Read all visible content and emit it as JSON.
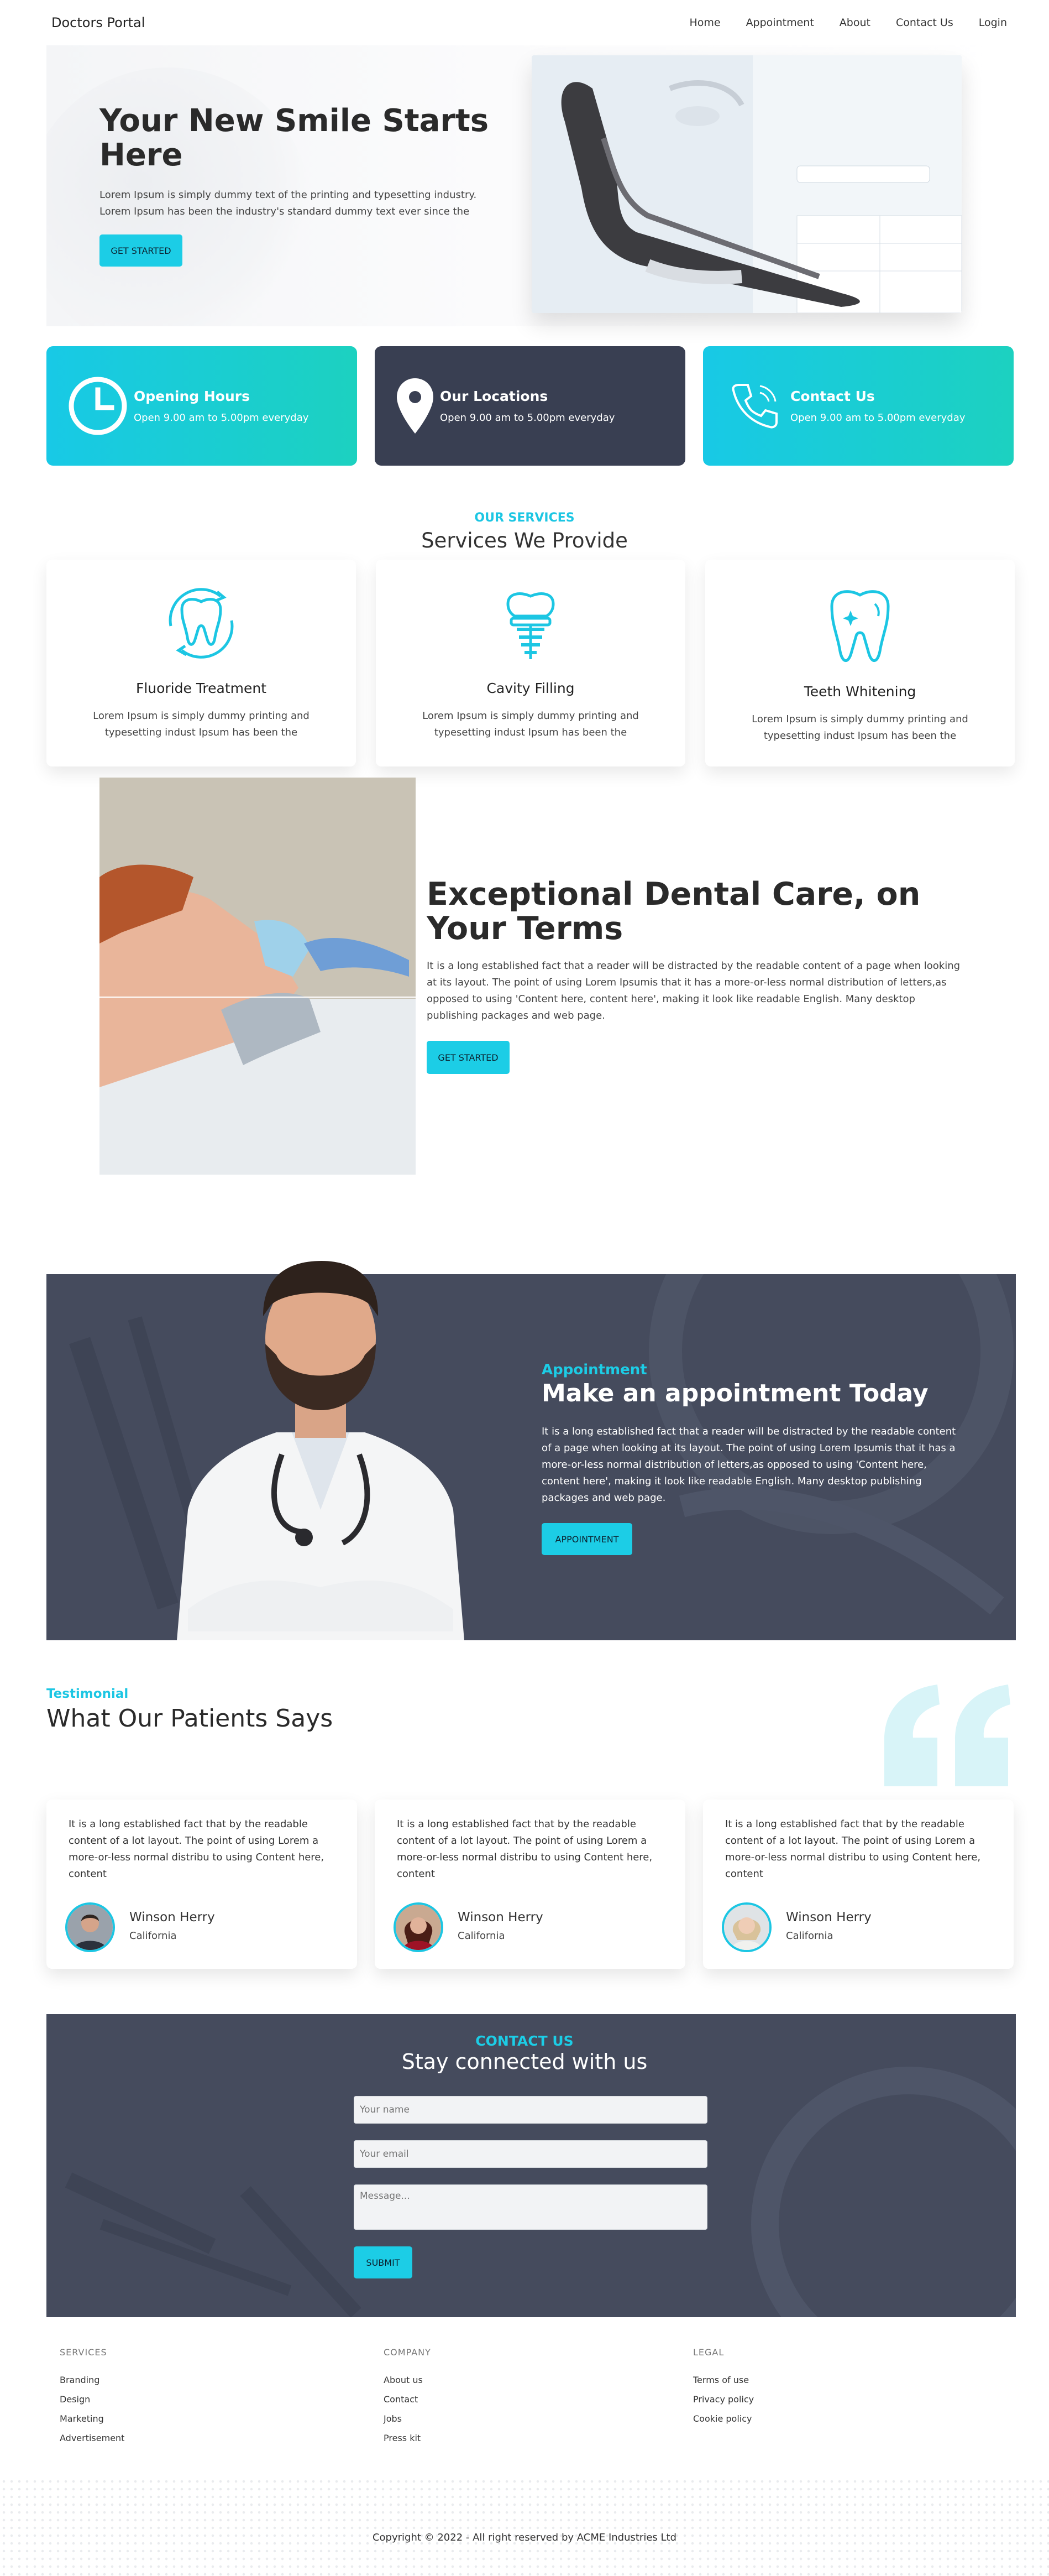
{
  "nav": {
    "brand": "Doctors Portal",
    "items": [
      "Home",
      "Appointment",
      "About",
      "Contact Us",
      "Login"
    ]
  },
  "hero": {
    "title": "Your New Smile Starts Here",
    "text": "Lorem Ipsum is simply dummy text of the printing and typesetting industry. Lorem Ipsum has been the industry's standard dummy text ever since the",
    "button": "GET STARTED"
  },
  "info": [
    {
      "title": "Opening Hours",
      "text": "Open 9.00 am to 5.00pm everyday",
      "icon": "clock-icon"
    },
    {
      "title": "Our Locations",
      "text": "Open 9.00 am to 5.00pm everyday",
      "icon": "location-pin-icon"
    },
    {
      "title": "Contact Us",
      "text": "Open 9.00 am to 5.00pm everyday",
      "icon": "phone-icon"
    }
  ],
  "services": {
    "eyebrow": "OUR SERVICES",
    "title": "Services We Provide",
    "items": [
      {
        "name": "Fluoride Treatment",
        "desc": "Lorem Ipsum is simply dummy printing and typesetting indust Ipsum has been the",
        "icon": "tooth-fluoride-icon"
      },
      {
        "name": "Cavity Filling",
        "desc": "Lorem Ipsum is simply dummy printing and typesetting indust Ipsum has been the",
        "icon": "tooth-implant-icon"
      },
      {
        "name": "Teeth Whitening",
        "desc": "Lorem Ipsum is simply dummy printing and typesetting indust Ipsum has been the",
        "icon": "tooth-sparkle-icon"
      }
    ]
  },
  "care": {
    "title": "Exceptional Dental Care, on Your Terms",
    "text": "It is a long established fact that a reader will be distracted by the readable content of a page when looking at its layout. The point of using Lorem Ipsumis that it has a more-or-less normal distribution of letters,as opposed to using 'Content here, content here', making it look like readable English. Many desktop publishing packages and web page.",
    "button": "GET STARTED"
  },
  "appointment": {
    "eyebrow": "Appointment",
    "title": "Make an appointment Today",
    "text": "It is a long established fact that a reader will be distracted by the readable content of a page when looking at its layout. The point of using Lorem Ipsumis that it has a more-or-less normal distribution of letters,as opposed to using 'Content here, content here', making it look like readable English. Many desktop publishing packages and web page.",
    "button": "APPOINTMENT"
  },
  "testimonials": {
    "eyebrow": "Testimonial",
    "title": "What Our Patients Says",
    "items": [
      {
        "text": "It is a long established fact that by the readable content of a lot layout. The point of using Lorem a more-or-less normal distribu to using Content here, content",
        "name": "Winson Herry",
        "location": "California"
      },
      {
        "text": "It is a long established fact that by the readable content of a lot layout. The point of using Lorem a more-or-less normal distribu to using Content here, content",
        "name": "Winson Herry",
        "location": "California"
      },
      {
        "text": "It is a long established fact that by the readable content of a lot layout. The point of using Lorem a more-or-less normal distribu to using Content here, content",
        "name": "Winson Herry",
        "location": "California"
      }
    ]
  },
  "contact": {
    "eyebrow": "CONTACT US",
    "title": "Stay connected with us",
    "name_placeholder": "Your name",
    "email_placeholder": "Your email",
    "message_placeholder": "Message...",
    "button": "SUBMIT"
  },
  "footer": {
    "columns": [
      {
        "heading": "SERVICES",
        "links": [
          "Branding",
          "Design",
          "Marketing",
          "Advertisement"
        ]
      },
      {
        "heading": "COMPANY",
        "links": [
          "About us",
          "Contact",
          "Jobs",
          "Press kit"
        ]
      },
      {
        "heading": "LEGAL",
        "links": [
          "Terms of use",
          "Privacy policy",
          "Cookie policy"
        ]
      }
    ],
    "copyright": "Copyright © 2022 - All right reserved by ACME Industries Ltd"
  },
  "colors": {
    "accent": "#1ccde6",
    "accent_green": "#1cd1c0",
    "dark_card": "#393f52",
    "dark_section": "#454b5d"
  }
}
